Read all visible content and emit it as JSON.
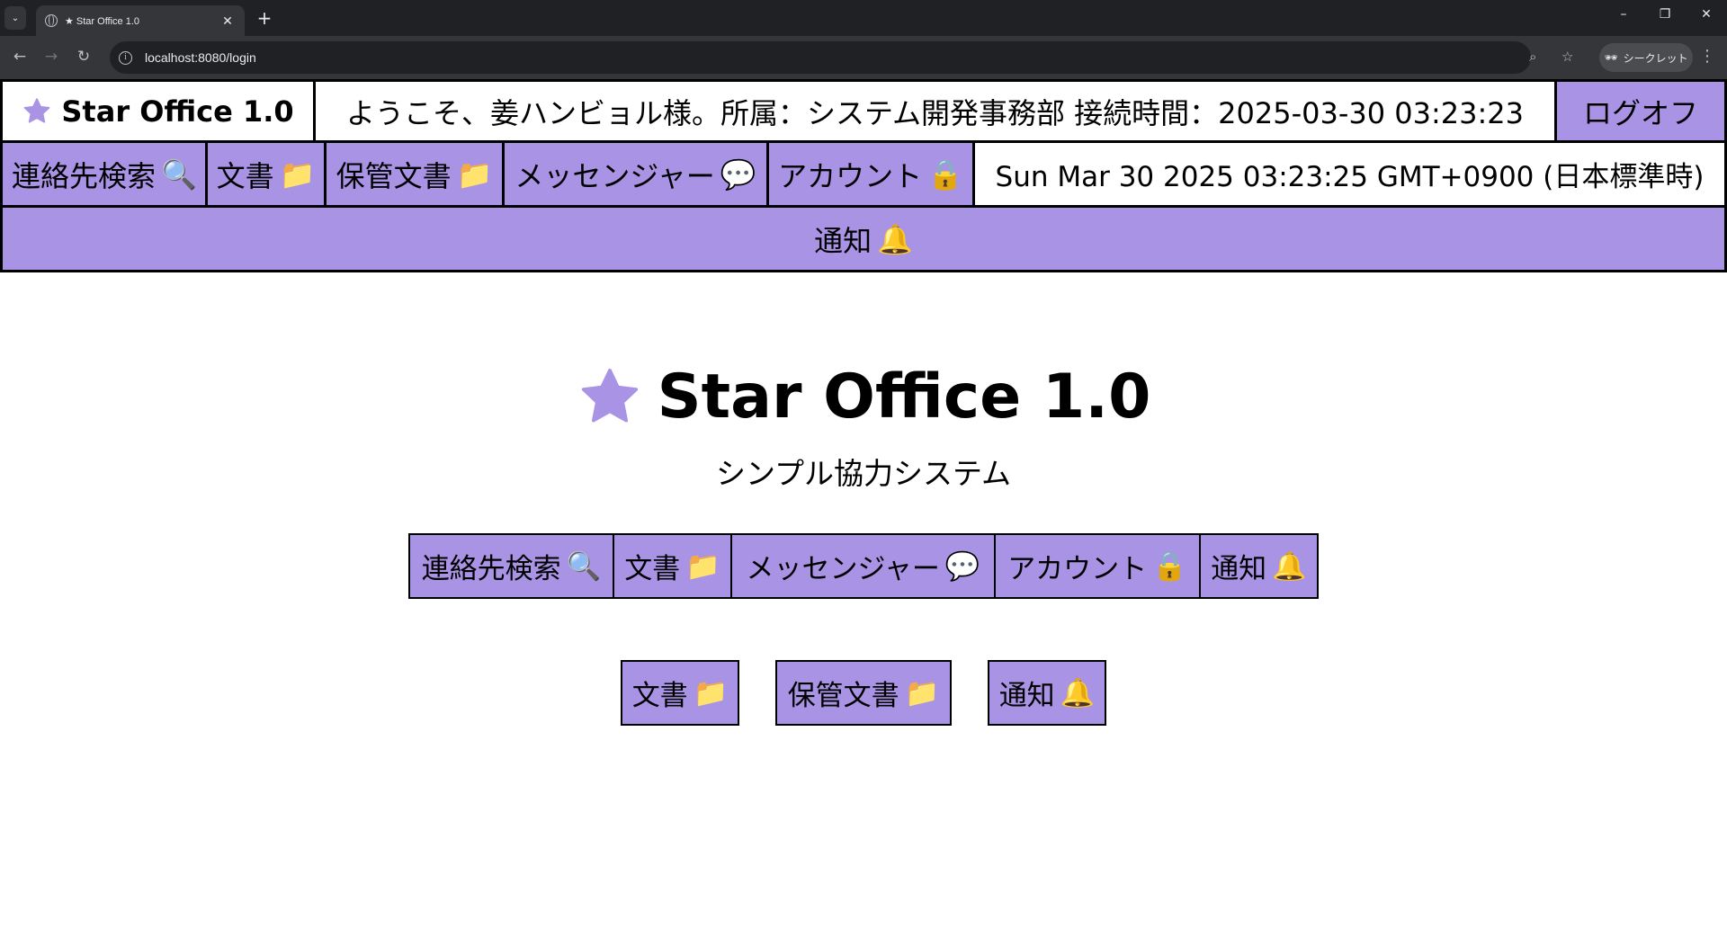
{
  "browser": {
    "tab_title": "★ Star Office 1.0",
    "url": "localhost:8080/login",
    "incognito_label": "シークレット"
  },
  "header": {
    "brand": "Star Office 1.0",
    "welcome": "ようこそ、姜ハンビョル様。所属：システム開発事務部 接続時間：2025-03-30 03:23:23",
    "logoff_label": "ログオフ"
  },
  "nav": {
    "contacts": "連絡先検索",
    "documents": "文書",
    "archived": "保管文書",
    "messenger": "メッセンジャー",
    "account": "アカウント",
    "datetime": "Sun Mar 30 2025 03:23:25 GMT+0900 (日本標準時)",
    "notifications": "通知"
  },
  "hero": {
    "title": "Star Office 1.0",
    "subtitle": "シンプル協力システム"
  },
  "menu_row": {
    "contacts": "連絡先検索",
    "documents": "文書",
    "messenger": "メッセンジャー",
    "account": "アカウント",
    "notifications": "通知"
  },
  "quick_row": {
    "documents": "文書",
    "archived": "保管文書",
    "notifications": "通知"
  },
  "icons": {
    "star": "star-icon",
    "search": "🔍",
    "folder": "📁",
    "speech": "💬",
    "lock": "🔒",
    "bell": "🔔"
  },
  "colors": {
    "accent": "#a993e5",
    "border": "#000000"
  }
}
